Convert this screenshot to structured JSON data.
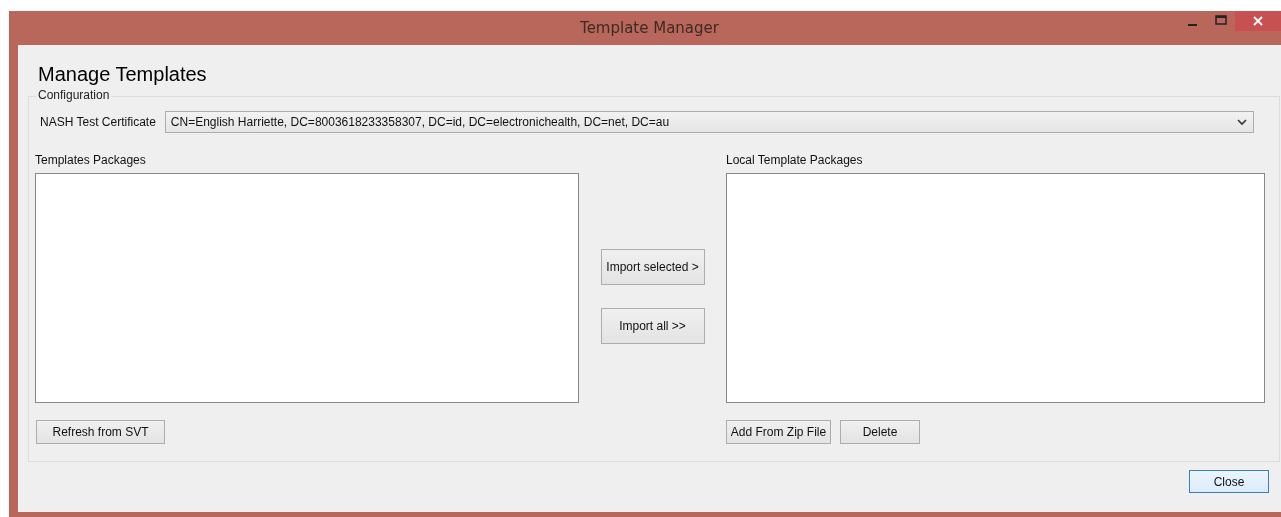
{
  "window": {
    "title": "Template Manager"
  },
  "heading": "Manage Templates",
  "configuration": {
    "legend": "Configuration",
    "certificate_label": "NASH Test Certificate",
    "certificate_value": "CN=English Harriette, DC=8003618233358307, DC=id, DC=electronichealth, DC=net, DC=au"
  },
  "templates_packages": {
    "label": "Templates Packages",
    "buttons": [
      "Refresh from SVT"
    ]
  },
  "transfer_buttons": [
    "Import selected >",
    "Import all >>"
  ],
  "local_template_packages": {
    "label": "Local Template Packages",
    "buttons": [
      "Add From Zip File",
      "Delete"
    ]
  },
  "footer_buttons": [
    "Close"
  ]
}
